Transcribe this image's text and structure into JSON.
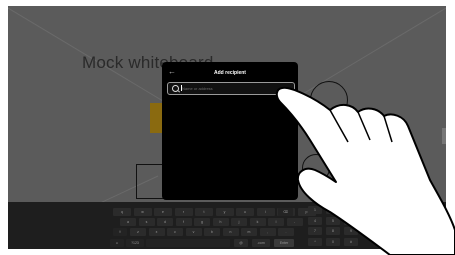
{
  "whiteboard": {
    "title": "Mock whiteboard"
  },
  "dialog": {
    "title": "Add recipient",
    "back_icon": "back-arrow-icon",
    "search": {
      "placeholder": "Name or address",
      "value": ""
    }
  },
  "keyboard": {
    "row1": [
      "q",
      "w",
      "e",
      "r",
      "t",
      "y",
      "u",
      "i",
      "o",
      "p"
    ],
    "row2": [
      "a",
      "s",
      "d",
      "f",
      "g",
      "h",
      "j",
      "k",
      "l",
      "-"
    ],
    "row3": [
      "z",
      "x",
      "c",
      "v",
      "b",
      "n",
      "m",
      ",",
      "."
    ],
    "row4": [
      ".com",
      "Enter"
    ],
    "special": {
      "emoji": "☺",
      "symbols": "?123",
      "backspace_icon": "backspace-icon",
      "shift_icon": "shift-icon"
    },
    "numpad": [
      "1",
      "2",
      "3",
      "4",
      "5",
      "6",
      "7",
      "8",
      "9",
      "*",
      "0",
      "#"
    ]
  },
  "colors": {
    "dialog_bg": "#000000",
    "screen_bg": "#5b5b5b",
    "keyboard_bg": "#1e1e1e"
  }
}
